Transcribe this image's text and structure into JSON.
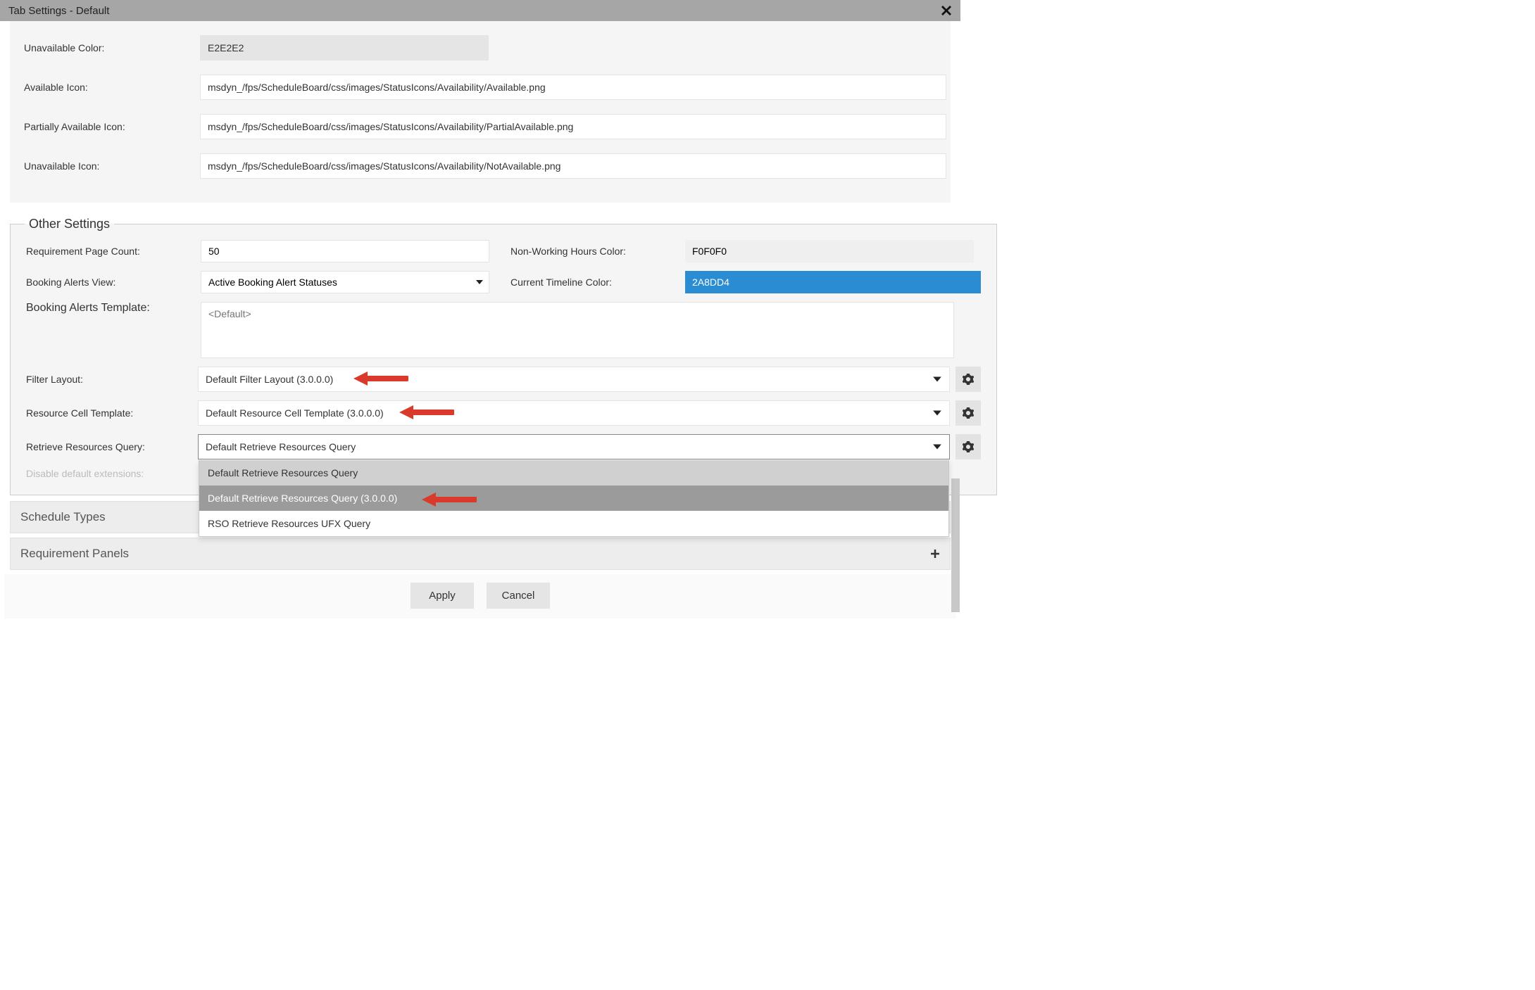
{
  "dialog": {
    "title": "Tab Settings - Default"
  },
  "top_fields": {
    "unavailable_color": {
      "label": "Unavailable Color:",
      "value": "E2E2E2"
    },
    "available_icon": {
      "label": "Available Icon:",
      "value": "msdyn_/fps/ScheduleBoard/css/images/StatusIcons/Availability/Available.png"
    },
    "partially_available_icon": {
      "label": "Partially Available Icon:",
      "value": "msdyn_/fps/ScheduleBoard/css/images/StatusIcons/Availability/PartialAvailable.png"
    },
    "unavailable_icon": {
      "label": "Unavailable Icon:",
      "value": "msdyn_/fps/ScheduleBoard/css/images/StatusIcons/Availability/NotAvailable.png"
    }
  },
  "other_settings": {
    "legend": "Other Settings",
    "requirement_page_count": {
      "label": "Requirement Page Count:",
      "value": "50"
    },
    "booking_alerts_view": {
      "label": "Booking Alerts View:",
      "value": "Active Booking Alert Statuses"
    },
    "booking_alerts_template": {
      "label": "Booking Alerts Template:",
      "placeholder": "<Default>"
    },
    "non_working_hours_color": {
      "label": "Non-Working Hours Color:",
      "value": "F0F0F0"
    },
    "current_timeline_color": {
      "label": "Current Timeline Color:",
      "value": "2A8DD4"
    },
    "filter_layout": {
      "label": "Filter Layout:",
      "value": "Default Filter Layout (3.0.0.0)"
    },
    "resource_cell_template": {
      "label": "Resource Cell Template:",
      "value": "Default Resource Cell Template (3.0.0.0)"
    },
    "retrieve_resources_query": {
      "label": "Retrieve Resources Query:",
      "value": "Default Retrieve Resources Query",
      "options": [
        "Default Retrieve Resources Query",
        "Default Retrieve Resources Query (3.0.0.0)",
        "RSO Retrieve Resources UFX Query"
      ]
    },
    "disable_default_extensions": {
      "label": "Disable default extensions:"
    }
  },
  "accordions": {
    "schedule_types": "Schedule Types",
    "requirement_panels": "Requirement Panels"
  },
  "footer": {
    "apply": "Apply",
    "cancel": "Cancel"
  }
}
